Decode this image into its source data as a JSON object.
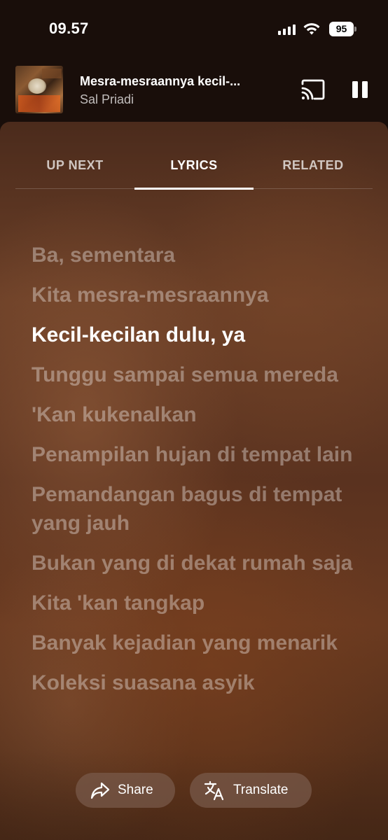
{
  "status_bar": {
    "time": "09.57",
    "battery": "95"
  },
  "now_playing": {
    "title": "Mesra-mesraannya kecil-...",
    "artist": "Sal Priadi",
    "cast_icon": "cast-icon",
    "pause_icon": "pause-icon"
  },
  "tabs": [
    {
      "label": "UP NEXT",
      "active": false
    },
    {
      "label": "LYRICS",
      "active": true
    },
    {
      "label": "RELATED",
      "active": false
    }
  ],
  "lyrics": [
    "Ba, sementara",
    "Kita mesra-mesraannya",
    "Kecil-kecilan dulu, ya",
    "Tunggu sampai semua mereda",
    "'Kan kukenalkan",
    "Penampilan hujan di tempat lain",
    "Pemandangan bagus di tempat yang jauh",
    "Bukan yang di dekat rumah saja",
    "Kita 'kan tangkap",
    "Banyak kejadian yang menarik",
    "Koleksi suasana asyik"
  ],
  "current_lyric_index": 2,
  "actions": {
    "share_label": "Share",
    "translate_label": "Translate"
  },
  "colors": {
    "background": "#190e0a",
    "sheet_brown": "#5a321f",
    "active_text": "#ffffff",
    "inactive_lyric": "rgba(255,255,255,0.35)"
  }
}
